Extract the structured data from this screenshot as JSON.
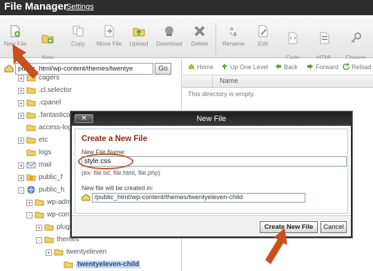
{
  "header": {
    "title": "File Manager",
    "settings_link": "Settings"
  },
  "toolbar": {
    "items": [
      {
        "label": "New File",
        "icon": "new-file-icon"
      },
      {
        "label": "New\nFolder",
        "icon": "new-folder-icon"
      },
      {
        "label": "Copy",
        "icon": "copy-icon"
      },
      {
        "label": "Move File",
        "icon": "move-file-icon"
      },
      {
        "label": "Upload",
        "icon": "upload-icon"
      },
      {
        "label": "Download",
        "icon": "download-icon"
      },
      {
        "label": "Delete",
        "icon": "delete-icon"
      },
      {
        "label": "Rename",
        "icon": "rename-icon"
      },
      {
        "label": "Edit",
        "icon": "edit-icon"
      },
      {
        "label": "Code\nEditor",
        "icon": "code-editor-icon"
      },
      {
        "label": "HTML\nEditor",
        "icon": "html-editor-icon"
      },
      {
        "label": "Change\nPermiss...",
        "icon": "permissions-icon"
      }
    ]
  },
  "left_panel": {
    "path_value": "public_html/wp-content/themes/twentye",
    "go_label": "Go",
    "tree": [
      {
        "label": "cagers",
        "toggle": "+"
      },
      {
        "label": ".cl.selector",
        "toggle": "+"
      },
      {
        "label": ".cpanel",
        "toggle": "+"
      },
      {
        "label": ".fantastico",
        "toggle": "+"
      },
      {
        "label": "access-logs",
        "toggle": ""
      },
      {
        "label": "etc",
        "toggle": "+"
      },
      {
        "label": "logs",
        "toggle": ""
      },
      {
        "label": "mail",
        "toggle": "+"
      },
      {
        "label": "public_f",
        "toggle": "+"
      },
      {
        "label": "public_h",
        "toggle": "-"
      },
      {
        "label": "wp-adm",
        "toggle": "+"
      },
      {
        "label": "wp-cont",
        "toggle": "-"
      },
      {
        "label": "plugi",
        "toggle": "+"
      },
      {
        "label": "themes",
        "toggle": "-"
      },
      {
        "label": "twentyeleven",
        "toggle": "+"
      },
      {
        "label": "twentyeleven-child",
        "toggle": ""
      }
    ]
  },
  "right_panel": {
    "nav": [
      {
        "label": "Home",
        "icon": "home-icon"
      },
      {
        "label": "Up One Level",
        "icon": "up-level-icon"
      },
      {
        "label": "Back",
        "icon": "back-icon"
      },
      {
        "label": "Forward",
        "icon": "forward-icon"
      },
      {
        "label": "Reload",
        "icon": "reload-icon"
      }
    ],
    "column_name": "Name",
    "empty_message": "This directory is empty."
  },
  "dialog": {
    "title": "New File",
    "close_label": "✕",
    "heading": "Create a New File",
    "file_name_label": "New File Name:",
    "file_name_value": "style.css",
    "example": "(ex: file.txt, file.html, file.php)",
    "location_label": "New file will be created in:",
    "location_value": "/public_html/wp-content/themes/twentyeleven-child",
    "create_label": "Create New File",
    "cancel_label": "Cancel"
  },
  "colors": {
    "header_bg": "#2e2e2e",
    "accent_arrow": "#c8501c",
    "dialog_heading": "#8a2a16",
    "selection": "#c4d9f3"
  }
}
